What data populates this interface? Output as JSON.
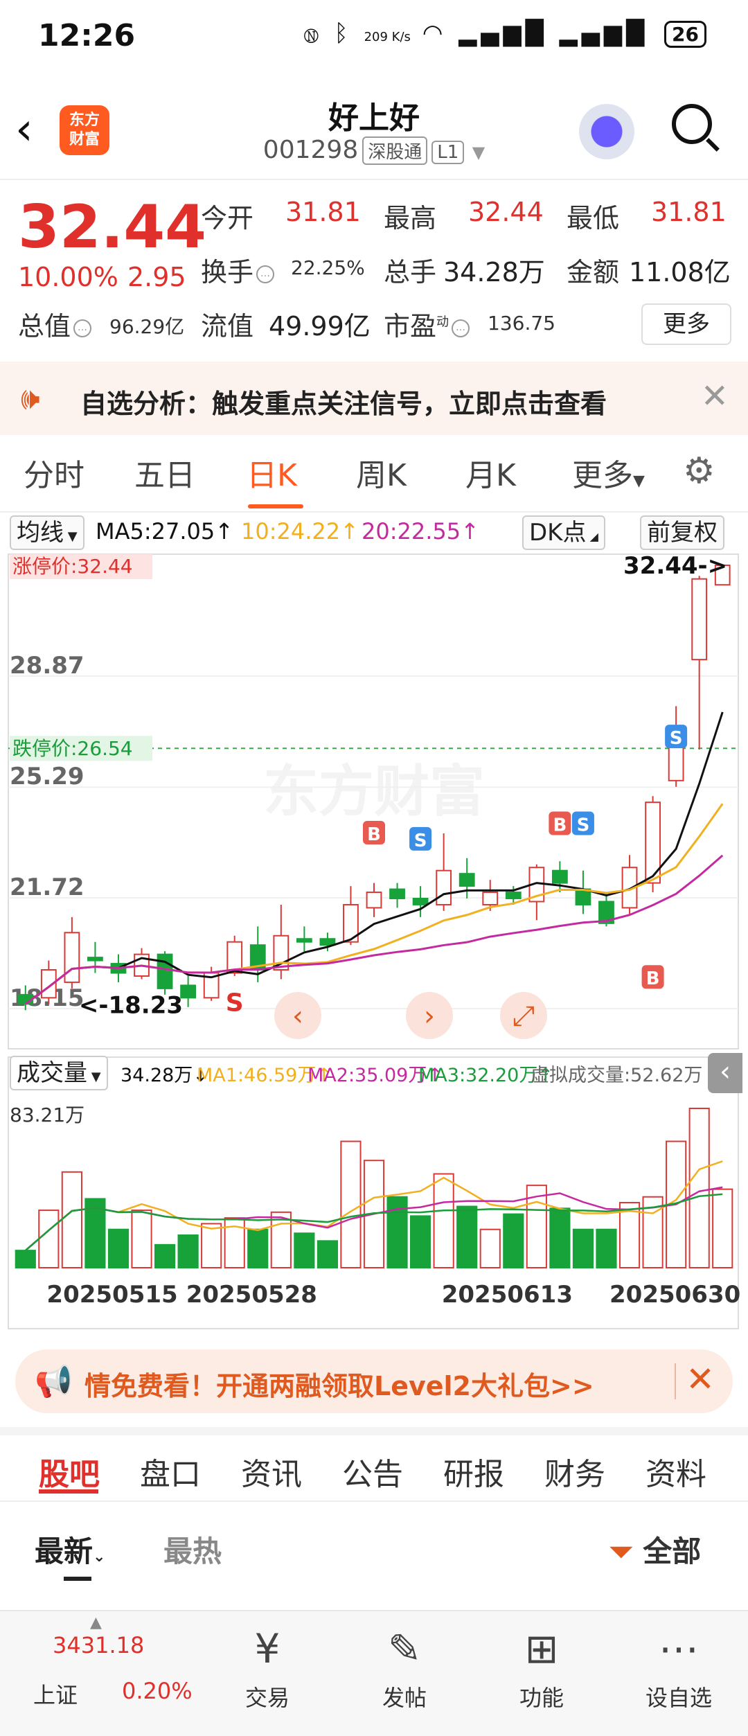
{
  "status_bar": {
    "time": "12:26",
    "net_speed": "209 K/s",
    "battery": "26"
  },
  "header": {
    "stock_name": "好上好",
    "stock_code": "001298",
    "market_tag": "深股通",
    "level_tag": "L1",
    "logo_line1": "东方",
    "logo_line2": "财富"
  },
  "quote": {
    "price": "32.44",
    "change_pct": "10.00%",
    "change": "2.95",
    "open_label": "今开",
    "open": "31.81",
    "high_label": "最高",
    "high": "32.44",
    "low_label": "最低",
    "low": "31.81",
    "turnover_rate_label": "换手",
    "turnover_rate": "22.25%",
    "volume_label": "总手",
    "volume": "34.28万",
    "amount_label": "金额",
    "amount": "11.08亿",
    "total_value_label": "总值",
    "total_value": "96.29亿",
    "float_value_label": "流值",
    "float_value": "49.99亿",
    "pe_label": "市盈",
    "pe_sup": "动",
    "pe": "136.75",
    "more_button": "更多"
  },
  "alert": {
    "text": "自选分析：触发重点关注信号，立即点击查看"
  },
  "period_tabs": [
    {
      "label": "分时"
    },
    {
      "label": "五日"
    },
    {
      "label": "日K"
    },
    {
      "label": "周K"
    },
    {
      "label": "月K"
    },
    {
      "label": "更多"
    }
  ],
  "indicators": {
    "main_select": "均线",
    "ma5": "MA5:27.05↑",
    "ma10": "10:24.22↑",
    "ma20": "20:22.55↑",
    "dk_select": "DK点",
    "adjust_select": "前复权"
  },
  "chart_labels": {
    "limit_up": "涨停价:32.44",
    "limit_down": "跌停价:26.54",
    "y_ticks": [
      "28.87",
      "25.29",
      "21.72",
      "18.15"
    ],
    "last_price": "32.44->",
    "low_marker": "<-18.23",
    "vol_select": "成交量",
    "vol": "34.28万↓",
    "vol_ma1": "MA1:46.59万↑",
    "vol_ma2": "MA2:35.09万↑",
    "vol_ma3": "MA3:32.20万↑",
    "virtual_vol": "虚拟成交量:52.62万",
    "vol_max": "83.21万",
    "x_ticks": [
      "20250515",
      "20250528",
      "20250613",
      "20250630"
    ],
    "signal_b": "B",
    "signal_s": "S"
  },
  "chart_data": {
    "type": "candlestick",
    "ylim": [
      18.15,
      32.44
    ],
    "volume_max": 83.21,
    "colors": {
      "up": "#d93a36",
      "down": "#17a33a",
      "ma5": "#111111",
      "ma10": "#f0b020",
      "ma20": "#c42aa0"
    },
    "candles": [
      {
        "o": 18.6,
        "c": 18.3,
        "h": 18.9,
        "l": 18.1,
        "v": 9
      },
      {
        "o": 18.5,
        "c": 19.4,
        "h": 19.7,
        "l": 18.3,
        "v": 30
      },
      {
        "o": 19.0,
        "c": 20.6,
        "h": 21.1,
        "l": 18.8,
        "v": 50
      },
      {
        "o": 19.8,
        "c": 19.7,
        "h": 20.3,
        "l": 19.3,
        "v": 36
      },
      {
        "o": 19.6,
        "c": 19.3,
        "h": 19.9,
        "l": 19.0,
        "v": 20
      },
      {
        "o": 19.2,
        "c": 19.9,
        "h": 20.1,
        "l": 19.1,
        "v": 30
      },
      {
        "o": 19.9,
        "c": 18.8,
        "h": 20.0,
        "l": 18.6,
        "v": 12
      },
      {
        "o": 18.9,
        "c": 18.5,
        "h": 19.2,
        "l": 18.2,
        "v": 17
      },
      {
        "o": 18.5,
        "c": 19.3,
        "h": 19.5,
        "l": 18.4,
        "v": 23
      },
      {
        "o": 19.3,
        "c": 20.3,
        "h": 20.5,
        "l": 19.2,
        "v": 26
      },
      {
        "o": 20.2,
        "c": 19.4,
        "h": 20.8,
        "l": 19.0,
        "v": 20
      },
      {
        "o": 19.4,
        "c": 20.5,
        "h": 21.5,
        "l": 19.1,
        "v": 29
      },
      {
        "o": 20.4,
        "c": 20.3,
        "h": 20.8,
        "l": 20.0,
        "v": 18
      },
      {
        "o": 20.4,
        "c": 20.2,
        "h": 20.6,
        "l": 20.0,
        "v": 14
      },
      {
        "o": 20.3,
        "c": 21.5,
        "h": 22.1,
        "l": 20.2,
        "v": 66
      },
      {
        "o": 21.4,
        "c": 21.9,
        "h": 22.2,
        "l": 21.1,
        "v": 56
      },
      {
        "o": 22.0,
        "c": 21.7,
        "h": 22.2,
        "l": 21.4,
        "v": 37
      },
      {
        "o": 21.7,
        "c": 21.5,
        "h": 22.1,
        "l": 21.1,
        "v": 27
      },
      {
        "o": 21.5,
        "c": 22.6,
        "h": 23.8,
        "l": 21.3,
        "v": 49
      },
      {
        "o": 22.5,
        "c": 22.1,
        "h": 23.0,
        "l": 21.7,
        "v": 32
      },
      {
        "o": 21.5,
        "c": 21.9,
        "h": 22.3,
        "l": 21.3,
        "v": 20
      },
      {
        "o": 21.9,
        "c": 21.7,
        "h": 22.1,
        "l": 21.5,
        "v": 28
      },
      {
        "o": 21.6,
        "c": 22.7,
        "h": 22.8,
        "l": 21.0,
        "v": 43
      },
      {
        "o": 22.6,
        "c": 22.2,
        "h": 22.9,
        "l": 21.9,
        "v": 31
      },
      {
        "o": 22.0,
        "c": 21.5,
        "h": 22.6,
        "l": 21.2,
        "v": 20
      },
      {
        "o": 21.6,
        "c": 20.9,
        "h": 21.9,
        "l": 20.8,
        "v": 20
      },
      {
        "o": 21.4,
        "c": 22.7,
        "h": 23.1,
        "l": 21.2,
        "v": 34
      },
      {
        "o": 22.2,
        "c": 24.8,
        "h": 25.0,
        "l": 21.9,
        "v": 37
      },
      {
        "o": 25.5,
        "c": 26.6,
        "h": 27.9,
        "l": 25.3,
        "v": 66
      },
      {
        "o": 29.4,
        "c": 32.0,
        "h": 32.1,
        "l": 26.5,
        "v": 100
      },
      {
        "o": 31.81,
        "c": 32.44,
        "h": 32.44,
        "l": 31.81,
        "v": 41
      }
    ]
  },
  "banner": {
    "text": "情免费看！开通两融领取Level2大礼包>>"
  },
  "content_tabs": [
    {
      "label": "股吧"
    },
    {
      "label": "盘口"
    },
    {
      "label": "资讯"
    },
    {
      "label": "公告"
    },
    {
      "label": "研报"
    },
    {
      "label": "财务"
    },
    {
      "label": "资料"
    }
  ],
  "sort_tabs": {
    "latest": "最新",
    "hottest": "最热",
    "filter": "全部"
  },
  "bottom_nav": {
    "index_value": "3431.18",
    "index_name": "上证",
    "index_change": "0.20%",
    "items": [
      {
        "label": "交易",
        "icon": "trade-icon"
      },
      {
        "label": "发帖",
        "icon": "post-icon"
      },
      {
        "label": "功能",
        "icon": "apps-icon"
      },
      {
        "label": "设自选",
        "icon": "watchlist-icon"
      }
    ]
  }
}
